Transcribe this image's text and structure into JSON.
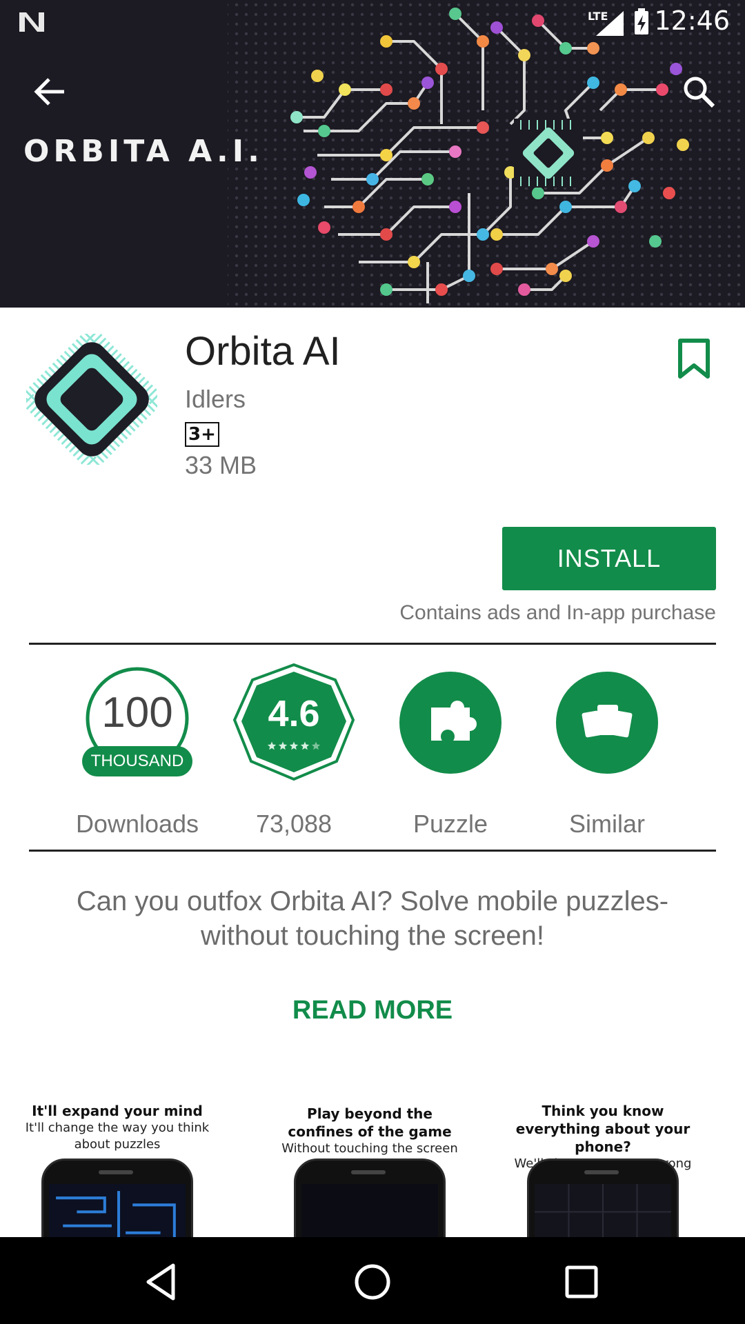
{
  "status_bar": {
    "network": "LTE",
    "time": "12:46"
  },
  "hero": {
    "banner_text": "ORBITA A.I.",
    "back_icon": "back-arrow-icon",
    "search_icon": "search-icon"
  },
  "app": {
    "title": "Orbita AI",
    "developer": "Idlers",
    "age_rating": "3+",
    "size": "33 MB",
    "install_label": "INSTALL",
    "ads_note": "Contains ads and In-app purchase",
    "accent_color": "#128c4a"
  },
  "stats": {
    "downloads": {
      "value": "100",
      "unit": "THOUSAND",
      "label": "Downloads"
    },
    "rating": {
      "value": "4.6",
      "stars": 4.6,
      "max_stars": 5,
      "label": "73,088"
    },
    "category": {
      "icon": "puzzle-icon",
      "label": "Puzzle"
    },
    "similar": {
      "icon": "cards-icon",
      "label": "Similar"
    }
  },
  "description": {
    "text": "Can you outfox Orbita AI? Solve mobile puzzles- without touching the screen!",
    "read_more": "READ MORE"
  },
  "screenshots": [
    {
      "title": "It'll expand your mind",
      "subtitle": "It'll change the way you think about puzzles"
    },
    {
      "title": "Play beyond the confines of the game",
      "subtitle": "Without touching the screen"
    },
    {
      "title": "Think you know everything about your phone?",
      "subtitle": "We'll show you you're wrong"
    }
  ],
  "nav_bar": {
    "back": "nav-back-icon",
    "home": "nav-home-icon",
    "recents": "nav-recents-icon"
  }
}
